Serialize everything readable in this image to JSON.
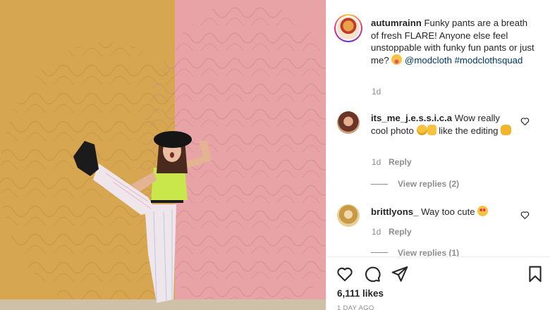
{
  "post": {
    "username": "autumrainn",
    "caption_text": "Funky pants are a breath of fresh FLARE! Anyone else feel unstoppable with funky fun pants or just me?",
    "mention": "@modcloth",
    "hashtag": "#modclothsquad",
    "time": "1d"
  },
  "comments": [
    {
      "username": "its_me_j.e.s.s.i.c.a",
      "text_a": "Wow really cool photo",
      "text_b": "like the editing",
      "time": "1d",
      "reply_label": "Reply",
      "view_replies": "View replies (2)"
    },
    {
      "username": "brittlyons_",
      "text_a": "Way too cute",
      "time": "1d",
      "reply_label": "Reply",
      "view_replies": "View replies (1)"
    }
  ],
  "footer": {
    "likes": "6,111 likes",
    "posted": "1 DAY AGO"
  },
  "icons": {
    "like": "heart-outline-icon",
    "comment": "speech-bubble-icon",
    "share": "paper-plane-icon",
    "save": "bookmark-icon"
  },
  "colors": {
    "wall_left": "#d6a650",
    "wall_right": "#e7a3a6",
    "link": "#00376b",
    "muted": "#8e8e8e"
  }
}
